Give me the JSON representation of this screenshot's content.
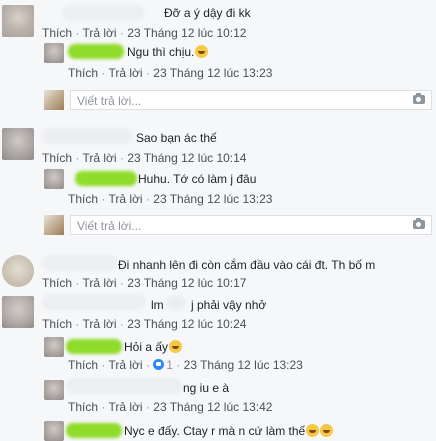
{
  "comments": [
    {
      "text": "Đỡ a ý dậy đi kk",
      "actions": {
        "like": "Thích",
        "reply": "Trả lời",
        "time": "23 Tháng 12 lúc 10:12"
      },
      "replies": [
        {
          "text": "Ngu thì chịu.",
          "emoji": "laughing-emoji",
          "actions": {
            "like": "Thích",
            "reply": "Trả lời",
            "time": "23 Tháng 12 lúc 13:23"
          }
        }
      ],
      "reply_box_placeholder": "Viết trả lời..."
    },
    {
      "text": "Sao bạn ác thế",
      "actions": {
        "like": "Thích",
        "reply": "Trả lời",
        "time": "23 Tháng 12 lúc 10:14"
      },
      "replies": [
        {
          "text": "Huhu. Tớ có làm j đâu",
          "actions": {
            "like": "Thích",
            "reply": "Trả lời",
            "time": "23 Tháng 12 lúc 13:23"
          }
        }
      ],
      "reply_box_placeholder": "Viết trả lời..."
    },
    {
      "text": "Đi nhanh lên đi còn cắm đầu vào cái đt. Th bố m",
      "actions": {
        "like": "Thích",
        "reply": "Trả lời",
        "time": "23 Tháng 12 lúc 10:17"
      }
    },
    {
      "text_a": "lm",
      "text_b": "j phải vậy nhở",
      "actions": {
        "like": "Thích",
        "reply": "Trả lời",
        "time": "23 Tháng 12 lúc 10:24"
      },
      "replies": [
        {
          "text": "Hỏi a ấy",
          "emoji": "laughing-emoji",
          "actions": {
            "like": "Thích",
            "reply": "Trả lời",
            "likes": "1",
            "time": "23 Tháng 12 lúc 13:23"
          }
        },
        {
          "text": "ng iu e à",
          "actions": {
            "like": "Thích",
            "reply": "Trả lời",
            "time": "23 Tháng 12 lúc 13:42"
          }
        },
        {
          "text": "Nyc e đấy. Ctay r mà n cứ làm thế",
          "emoji": "laughing-emoji"
        }
      ]
    }
  ]
}
